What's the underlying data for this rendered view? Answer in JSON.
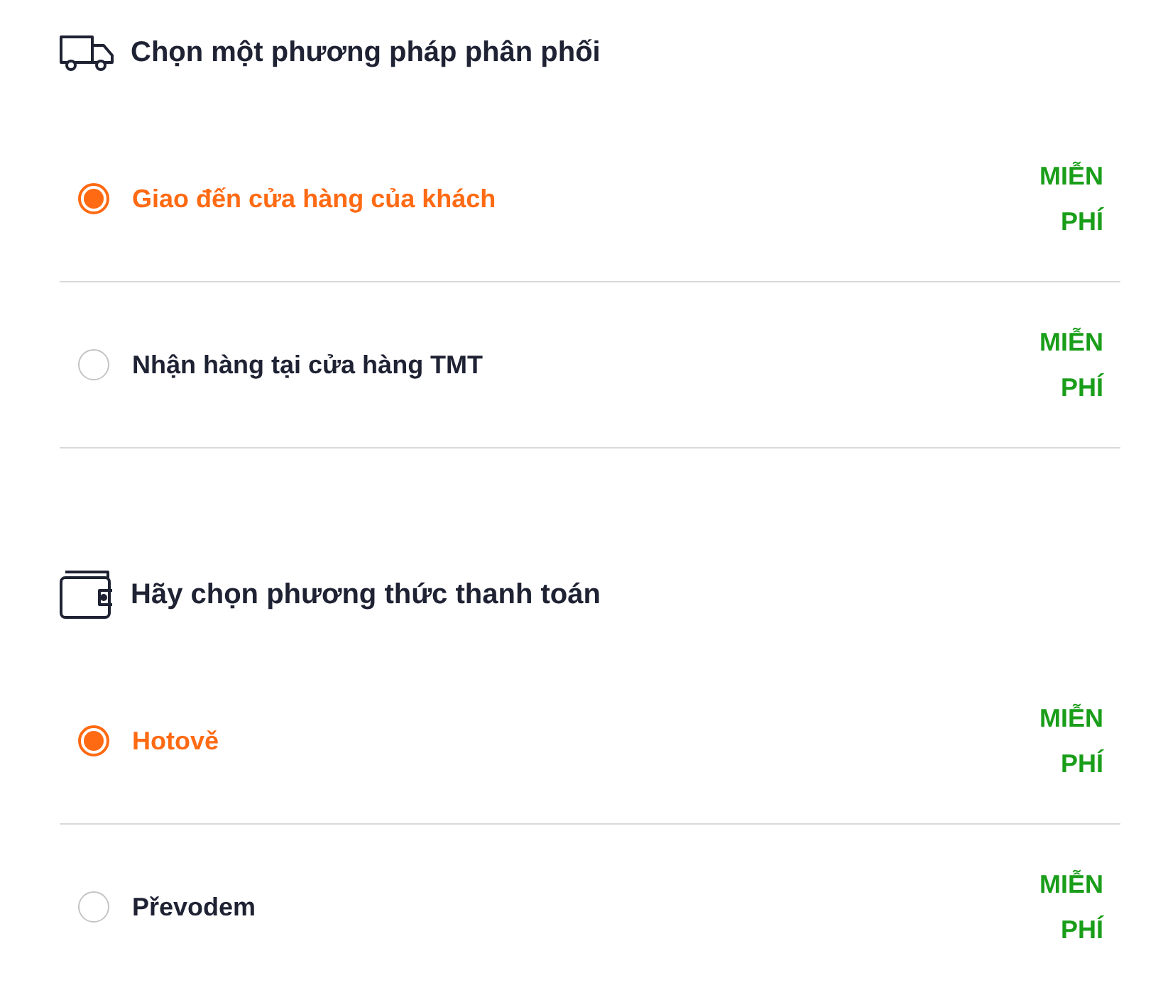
{
  "sections": [
    {
      "kind": "delivery",
      "title": "Chọn một phương pháp phân phối",
      "options": [
        {
          "label": "Giao đến cửa hàng của khách",
          "selected": true,
          "price": "MIỄN PHÍ"
        },
        {
          "label": "Nhận hàng tại cửa hàng TMT",
          "selected": false,
          "price": "MIỄN PHÍ"
        }
      ]
    },
    {
      "kind": "payment",
      "title": "Hãy chọn phương thức thanh toán",
      "options": [
        {
          "label": "Hotově",
          "selected": true,
          "price": "MIỄN PHÍ"
        },
        {
          "label": "Převodem",
          "selected": false,
          "price": "MIỄN PHÍ"
        }
      ]
    }
  ]
}
